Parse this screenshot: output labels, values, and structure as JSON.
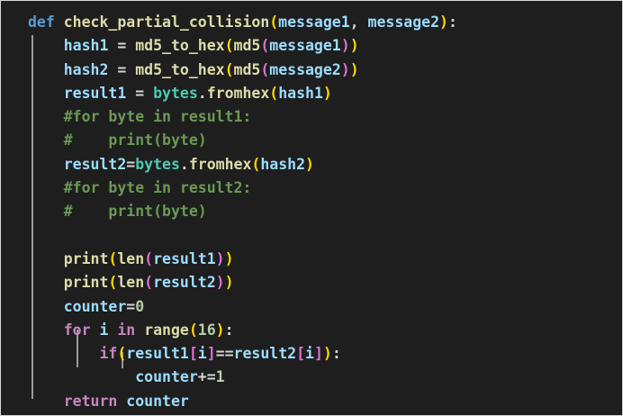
{
  "code": {
    "lines": [
      [
        [
          "kw",
          "def"
        ],
        [
          "op",
          " "
        ],
        [
          "fn",
          "check_partial_collision"
        ],
        [
          "p1",
          "("
        ],
        [
          "var",
          "message1"
        ],
        [
          "op",
          ", "
        ],
        [
          "var",
          "message2"
        ],
        [
          "p1",
          ")"
        ],
        [
          "op",
          ":"
        ]
      ],
      [
        [
          "op",
          "    "
        ],
        [
          "var",
          "hash1"
        ],
        [
          "op",
          " = "
        ],
        [
          "fn",
          "md5_to_hex"
        ],
        [
          "p1",
          "("
        ],
        [
          "fn",
          "md5"
        ],
        [
          "p2",
          "("
        ],
        [
          "var",
          "message1"
        ],
        [
          "p2",
          ")"
        ],
        [
          "p1",
          ")"
        ]
      ],
      [
        [
          "op",
          "    "
        ],
        [
          "var",
          "hash2"
        ],
        [
          "op",
          " = "
        ],
        [
          "fn",
          "md5_to_hex"
        ],
        [
          "p1",
          "("
        ],
        [
          "fn",
          "md5"
        ],
        [
          "p2",
          "("
        ],
        [
          "var",
          "message2"
        ],
        [
          "p2",
          ")"
        ],
        [
          "p1",
          ")"
        ]
      ],
      [
        [
          "op",
          "    "
        ],
        [
          "var",
          "result1"
        ],
        [
          "op",
          " = "
        ],
        [
          "cls",
          "bytes"
        ],
        [
          "op",
          "."
        ],
        [
          "fn",
          "fromhex"
        ],
        [
          "p1",
          "("
        ],
        [
          "var",
          "hash1"
        ],
        [
          "p1",
          ")"
        ]
      ],
      [
        [
          "op",
          "    "
        ],
        [
          "cmt",
          "#for byte in result1:"
        ]
      ],
      [
        [
          "op",
          "    "
        ],
        [
          "cmt",
          "#    print(byte)"
        ]
      ],
      [
        [
          "op",
          "    "
        ],
        [
          "var",
          "result2"
        ],
        [
          "op",
          "="
        ],
        [
          "cls",
          "bytes"
        ],
        [
          "op",
          "."
        ],
        [
          "fn",
          "fromhex"
        ],
        [
          "p1",
          "("
        ],
        [
          "var",
          "hash2"
        ],
        [
          "p1",
          ")"
        ]
      ],
      [
        [
          "op",
          "    "
        ],
        [
          "cmt",
          "#for byte in result2:"
        ]
      ],
      [
        [
          "op",
          "    "
        ],
        [
          "cmt",
          "#    print(byte)"
        ]
      ],
      [
        [
          "op",
          ""
        ]
      ],
      [
        [
          "op",
          "    "
        ],
        [
          "fn",
          "print"
        ],
        [
          "p1",
          "("
        ],
        [
          "fn",
          "len"
        ],
        [
          "p2",
          "("
        ],
        [
          "var",
          "result1"
        ],
        [
          "p2",
          ")"
        ],
        [
          "p1",
          ")"
        ]
      ],
      [
        [
          "op",
          "    "
        ],
        [
          "fn",
          "print"
        ],
        [
          "p1",
          "("
        ],
        [
          "fn",
          "len"
        ],
        [
          "p2",
          "("
        ],
        [
          "var",
          "result2"
        ],
        [
          "p2",
          ")"
        ],
        [
          "p1",
          ")"
        ]
      ],
      [
        [
          "op",
          "    "
        ],
        [
          "var",
          "counter"
        ],
        [
          "op",
          "="
        ],
        [
          "num",
          "0"
        ]
      ],
      [
        [
          "op",
          "    "
        ],
        [
          "ctl",
          "for"
        ],
        [
          "op",
          " "
        ],
        [
          "var",
          "i"
        ],
        [
          "op",
          " "
        ],
        [
          "ctl",
          "in"
        ],
        [
          "op",
          " "
        ],
        [
          "fn",
          "range"
        ],
        [
          "p1",
          "("
        ],
        [
          "num",
          "16"
        ],
        [
          "p1",
          ")"
        ],
        [
          "op",
          ":"
        ]
      ],
      [
        [
          "op",
          "        "
        ],
        [
          "ctl",
          "if"
        ],
        [
          "p1",
          "("
        ],
        [
          "var",
          "result1"
        ],
        [
          "p2",
          "["
        ],
        [
          "var",
          "i"
        ],
        [
          "p2",
          "]"
        ],
        [
          "op",
          "=="
        ],
        [
          "var",
          "result2"
        ],
        [
          "p2",
          "["
        ],
        [
          "var",
          "i"
        ],
        [
          "p2",
          "]"
        ],
        [
          "p1",
          ")"
        ],
        [
          "op",
          ":"
        ]
      ],
      [
        [
          "op",
          "            "
        ],
        [
          "var",
          "counter"
        ],
        [
          "op",
          "+="
        ],
        [
          "num",
          "1"
        ]
      ],
      [
        [
          "op",
          "    "
        ],
        [
          "ctl",
          "return"
        ],
        [
          "op",
          " "
        ],
        [
          "var",
          "counter"
        ]
      ]
    ]
  }
}
